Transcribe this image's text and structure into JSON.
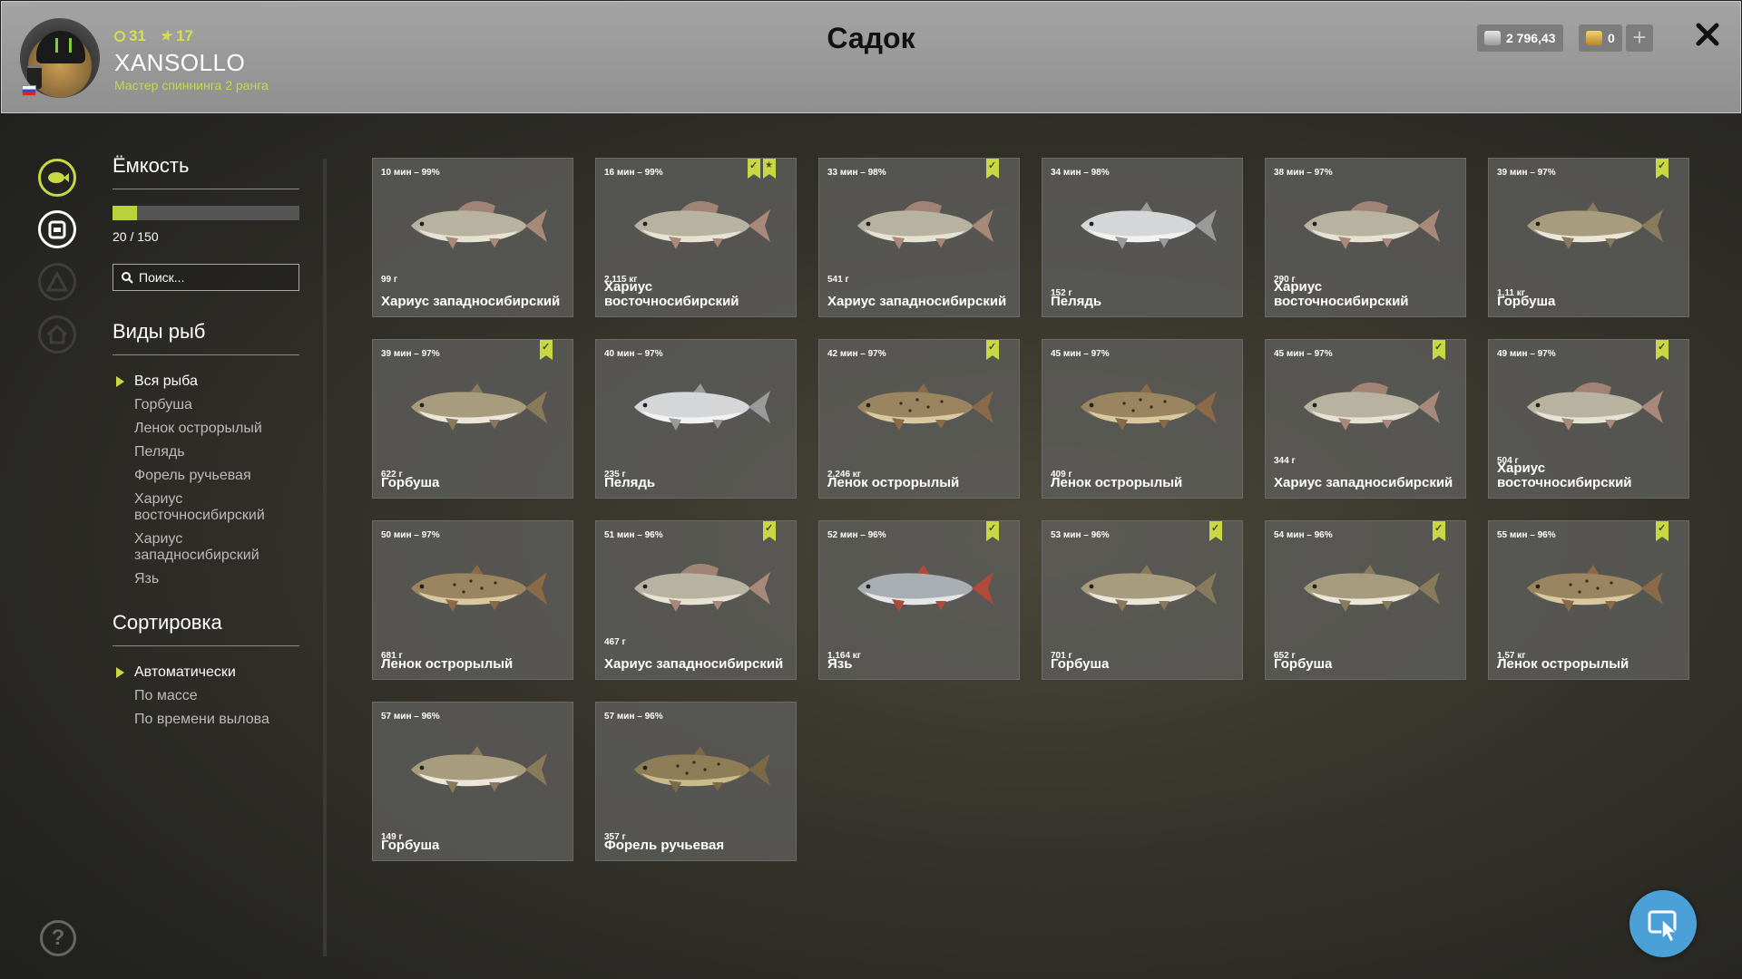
{
  "header": {
    "level": "31",
    "stars": "17",
    "username": "XANSOLLO",
    "rank": "Мастер спиннинга 2 ранга",
    "title": "Садок",
    "silver": "2 796,43",
    "gold": "0"
  },
  "panel": {
    "capacity_title": "Ёмкость",
    "capacity_text": "20 / 150",
    "capacity_fraction": 0.133,
    "search_placeholder": "Поиск...",
    "species_title": "Виды рыб",
    "species": [
      "Вся рыба",
      "Горбуша",
      "Ленок острорылый",
      "Пелядь",
      "Форель ручьевая",
      "Хариус восточносибирский",
      "Хариус западносибирский",
      "Язь"
    ],
    "sort_title": "Сортировка",
    "sort": [
      "Автоматически",
      "По массе",
      "По времени вылова"
    ]
  },
  "fish": [
    {
      "time": "10 мин – 99%",
      "weight": "99 г",
      "name": "Хариус западносибирский",
      "kind": "grayling",
      "marks": []
    },
    {
      "time": "16 мин – 99%",
      "weight": "2,115 кг",
      "name": "Хариус восточносибирский",
      "kind": "grayling",
      "marks": [
        "check",
        "star"
      ]
    },
    {
      "time": "33 мин – 98%",
      "weight": "541 г",
      "name": "Хариус западносибирский",
      "kind": "grayling",
      "marks": [
        "check"
      ]
    },
    {
      "time": "34 мин – 98%",
      "weight": "152 г",
      "name": "Пелядь",
      "kind": "peled",
      "marks": []
    },
    {
      "time": "38 мин – 97%",
      "weight": "290 г",
      "name": "Хариус восточносибирский",
      "kind": "grayling",
      "marks": []
    },
    {
      "time": "39 мин – 97%",
      "weight": "1,11 кг",
      "name": "Горбуша",
      "kind": "salmon",
      "marks": [
        "check"
      ]
    },
    {
      "time": "39 мин – 97%",
      "weight": "622 г",
      "name": "Горбуша",
      "kind": "salmon",
      "marks": [
        "check"
      ]
    },
    {
      "time": "40 мин – 97%",
      "weight": "235 г",
      "name": "Пелядь",
      "kind": "peled",
      "marks": []
    },
    {
      "time": "42 мин – 97%",
      "weight": "2,246 кг",
      "name": "Ленок острорылый",
      "kind": "lenok",
      "marks": [
        "check"
      ]
    },
    {
      "time": "45 мин – 97%",
      "weight": "409 г",
      "name": "Ленок острорылый",
      "kind": "lenok",
      "marks": []
    },
    {
      "time": "45 мин – 97%",
      "weight": "344 г",
      "name": "Хариус западносибирский",
      "kind": "grayling",
      "marks": [
        "check"
      ]
    },
    {
      "time": "49 мин – 97%",
      "weight": "504 г",
      "name": "Хариус восточносибирский",
      "kind": "grayling",
      "marks": [
        "check"
      ]
    },
    {
      "time": "50 мин – 97%",
      "weight": "681 г",
      "name": "Ленок острорылый",
      "kind": "lenok",
      "marks": []
    },
    {
      "time": "51 мин – 96%",
      "weight": "467 г",
      "name": "Хариус западносибирский",
      "kind": "grayling",
      "marks": [
        "check"
      ]
    },
    {
      "time": "52 мин – 96%",
      "weight": "1,164 кг",
      "name": "Язь",
      "kind": "ide",
      "marks": [
        "check"
      ]
    },
    {
      "time": "53 мин – 96%",
      "weight": "701 г",
      "name": "Горбуша",
      "kind": "salmon",
      "marks": [
        "check"
      ]
    },
    {
      "time": "54 мин – 96%",
      "weight": "652 г",
      "name": "Горбуша",
      "kind": "salmon",
      "marks": [
        "check"
      ]
    },
    {
      "time": "55 мин – 96%",
      "weight": "1,57 кг",
      "name": "Ленок острорылый",
      "kind": "lenok",
      "marks": [
        "check"
      ]
    },
    {
      "time": "57 мин – 96%",
      "weight": "149 г",
      "name": "Горбуша",
      "kind": "salmon",
      "marks": []
    },
    {
      "time": "57 мин – 96%",
      "weight": "357 г",
      "name": "Форель ручьевая",
      "kind": "trout",
      "marks": []
    }
  ],
  "colors": {
    "accent": "#c9d842",
    "cursor_button": "#4ca0d8"
  }
}
